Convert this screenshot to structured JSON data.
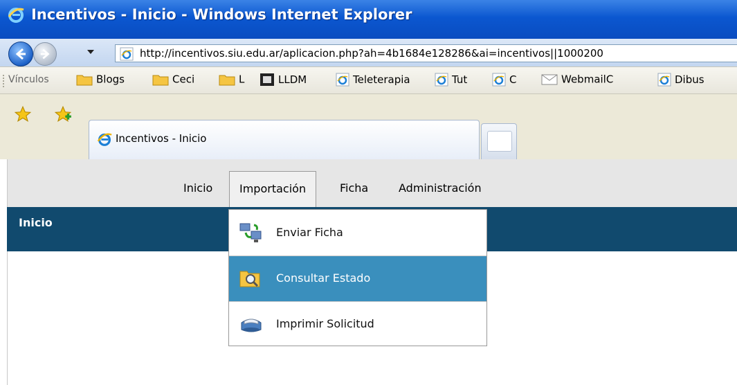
{
  "window": {
    "title": "Incentivos - Inicio - Windows Internet Explorer"
  },
  "address": {
    "url": "http://incentivos.siu.edu.ar/aplicacion.php?ah=4b1684e128286&ai=incentivos||1000200"
  },
  "links": {
    "label": "Vínculos",
    "items": [
      {
        "label": "Blogs",
        "icon": "folder-icon"
      },
      {
        "label": "Ceci",
        "icon": "folder-icon"
      },
      {
        "label": "L",
        "icon": "folder-icon"
      },
      {
        "label": "LLDM",
        "icon": "lldm-icon"
      },
      {
        "label": "Teleterapia",
        "icon": "ie-page-icon"
      },
      {
        "label": "Tut",
        "icon": "ie-page-icon"
      },
      {
        "label": "C",
        "icon": "ie-page-icon"
      },
      {
        "label": "WebmailC",
        "icon": "mail-icon"
      },
      {
        "label": "Dibus",
        "icon": "ie-page-icon"
      }
    ]
  },
  "tab": {
    "label": "Incentivos - Inicio"
  },
  "app": {
    "menu": [
      {
        "label": "Inicio"
      },
      {
        "label": "Importación"
      },
      {
        "label": "Ficha"
      },
      {
        "label": "Administración"
      }
    ],
    "section_title": "Inicio",
    "dropdown": [
      {
        "label": "Enviar Ficha",
        "icon": "send-network-icon"
      },
      {
        "label": "Consultar Estado",
        "icon": "folder-search-icon",
        "selected": true
      },
      {
        "label": "Imprimir Solicitud",
        "icon": "printer-icon"
      }
    ]
  },
  "colors": {
    "header_blue": "#114a6e",
    "selected_item": "#3a8fbd",
    "title_bar": "#0b57d0"
  }
}
